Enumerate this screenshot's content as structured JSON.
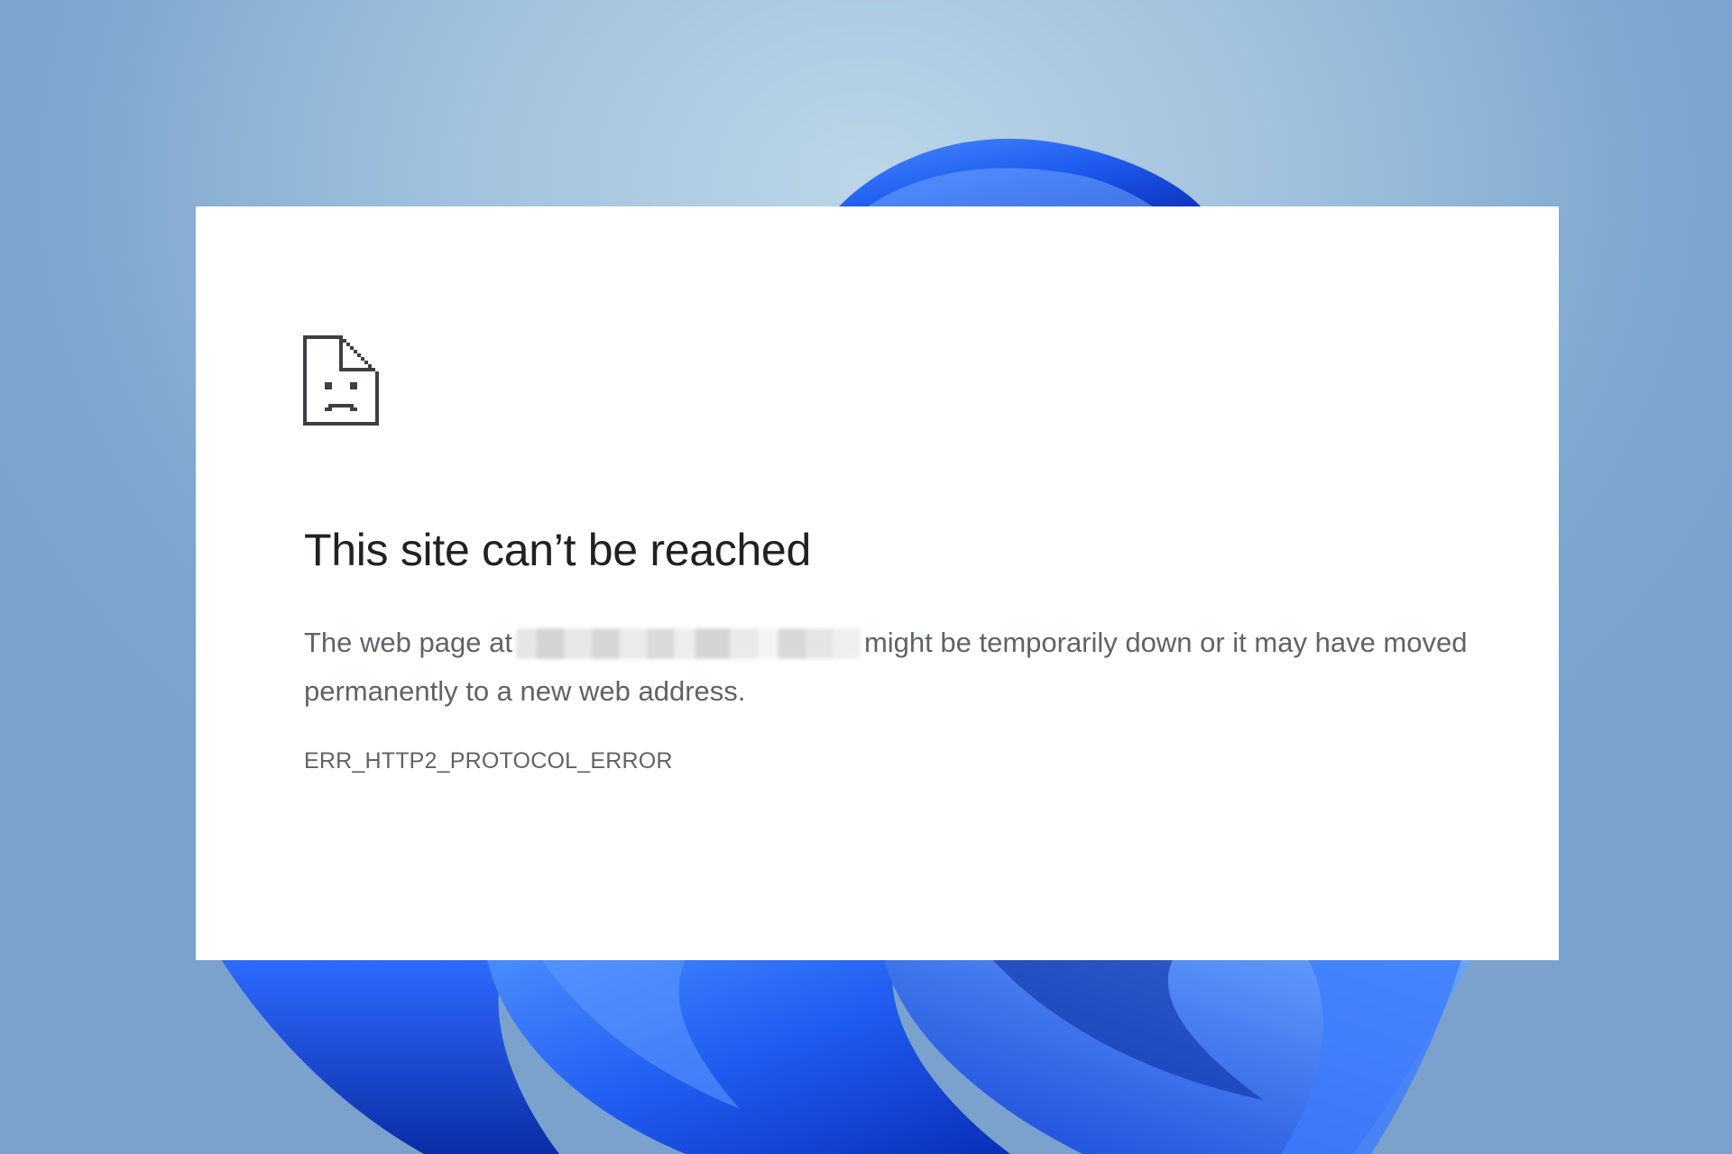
{
  "error_page": {
    "icon": "sad-page-icon",
    "headline": "This site can’t be reached",
    "message_before": "The web page at",
    "message_after": "might be temporarily down or it may have moved permanently to a new web address.",
    "error_code": "ERR_HTTP2_PROTOCOL_ERROR"
  },
  "colors": {
    "background": "#9fc0dc",
    "bloom_blue": "#1f5cf0",
    "card": "#ffffff",
    "headline_text": "#202124",
    "body_text": "#5f6368"
  }
}
